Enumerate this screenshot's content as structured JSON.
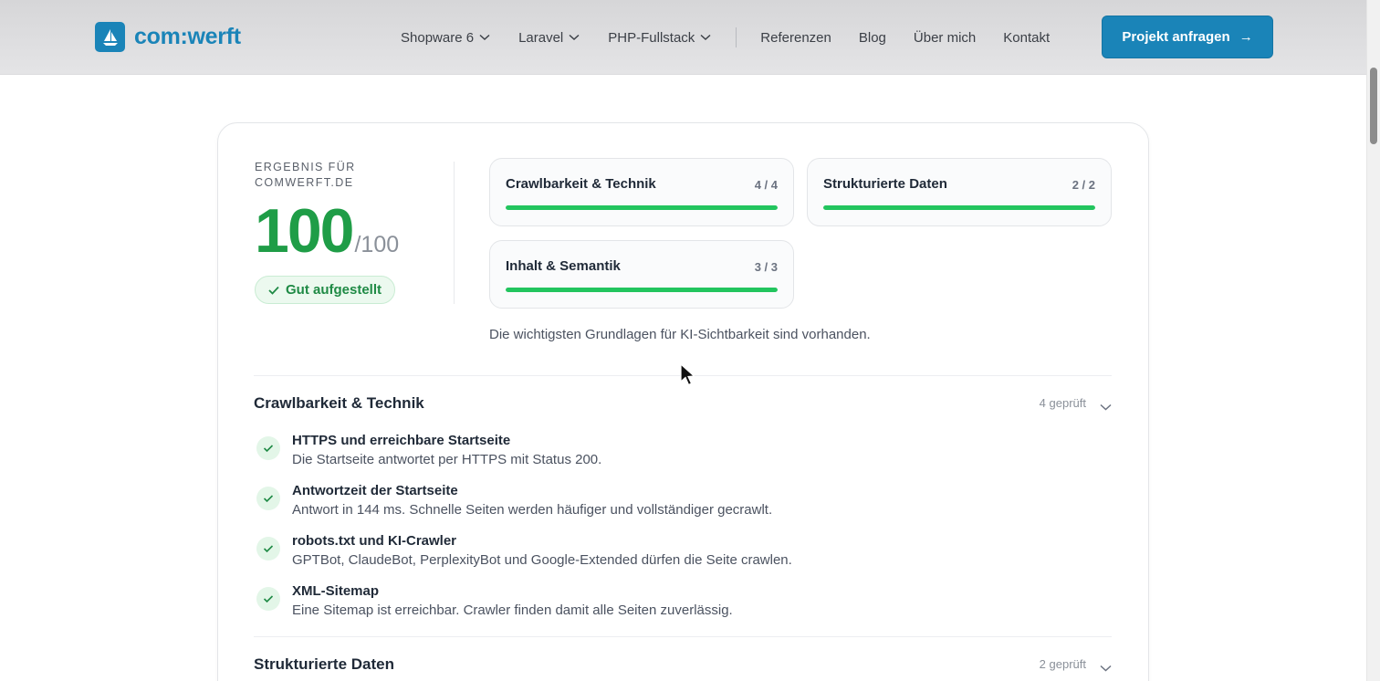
{
  "header": {
    "logo_text": "com:werft",
    "nav": [
      {
        "label": "Shopware 6",
        "dropdown": true
      },
      {
        "label": "Laravel",
        "dropdown": true
      },
      {
        "label": "PHP-Fullstack",
        "dropdown": true
      },
      {
        "label": "Referenzen",
        "dropdown": false
      },
      {
        "label": "Blog",
        "dropdown": false
      },
      {
        "label": "Über mich",
        "dropdown": false
      },
      {
        "label": "Kontakt",
        "dropdown": false
      }
    ],
    "cta_label": "Projekt anfragen",
    "cta_arrow": "→"
  },
  "result": {
    "label": "ERGEBNIS FÜR COMWERFT.DE",
    "score": "100",
    "score_max": "/100",
    "badge": "Gut aufgestellt",
    "summary": "Die wichtigsten Grundlagen für KI-Sichtbarkeit sind vorhanden."
  },
  "categories": [
    {
      "title": "Crawlbarkeit & Technik",
      "count": "4 / 4",
      "fraction": 1.0
    },
    {
      "title": "Strukturierte Daten",
      "count": "2 / 2",
      "fraction": 1.0
    },
    {
      "title": "Inhalt & Semantik",
      "count": "3 / 3",
      "fraction": 1.0
    }
  ],
  "sections": [
    {
      "title": "Crawlbarkeit & Technik",
      "meta": "4 geprüft",
      "items": [
        {
          "title": "HTTPS und erreichbare Startseite",
          "desc": "Die Startseite antwortet per HTTPS mit Status 200."
        },
        {
          "title": "Antwortzeit der Startseite",
          "desc": "Antwort in 144 ms. Schnelle Seiten werden häufiger und vollständiger gecrawlt."
        },
        {
          "title": "robots.txt und KI-Crawler",
          "desc": "GPTBot, ClaudeBot, PerplexityBot und Google-Extended dürfen die Seite crawlen."
        },
        {
          "title": "XML-Sitemap",
          "desc": "Eine Sitemap ist erreichbar. Crawler finden damit alle Seiten zuverlässig."
        }
      ]
    },
    {
      "title": "Strukturierte Daten",
      "meta": "2 geprüft",
      "items": []
    }
  ],
  "colors": {
    "brand": "#1a84b8",
    "success": "#1f9d47",
    "bar": "#22c55e"
  }
}
